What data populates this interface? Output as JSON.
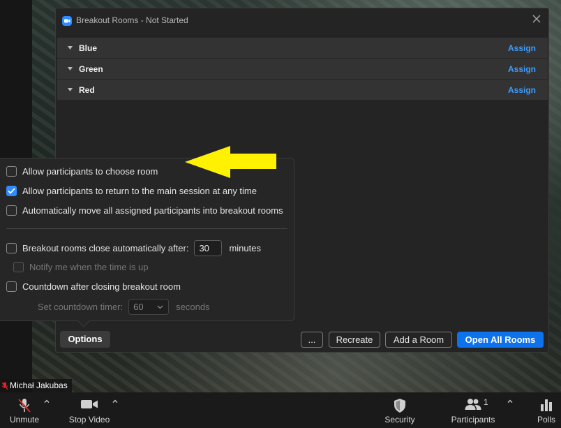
{
  "dialog": {
    "title": "Breakout Rooms - Not Started",
    "rooms": [
      {
        "name": "Blue",
        "action": "Assign"
      },
      {
        "name": "Green",
        "action": "Assign"
      },
      {
        "name": "Red",
        "action": "Assign"
      }
    ],
    "buttons": {
      "options": "Options",
      "more": "...",
      "recreate": "Recreate",
      "add_room": "Add a Room",
      "open_all": "Open All Rooms"
    }
  },
  "options": {
    "allow_choose": {
      "label": "Allow participants to choose room",
      "checked": false
    },
    "allow_return": {
      "label": "Allow participants to return to the main session at any time",
      "checked": true
    },
    "auto_move": {
      "label": "Automatically move all assigned participants into breakout rooms",
      "checked": false
    },
    "auto_close": {
      "label": "Breakout rooms close automatically after:",
      "value": "30",
      "unit": "minutes",
      "checked": false
    },
    "notify": {
      "label": "Notify me when the time is up",
      "checked": false
    },
    "countdown": {
      "label": "Countdown after closing breakout room",
      "checked": false
    },
    "countdown_timer": {
      "label": "Set countdown timer:",
      "value": "60",
      "unit": "seconds"
    }
  },
  "participant": {
    "name": "Michał Jakubas"
  },
  "toolbar": {
    "unmute": "Unmute",
    "stop_video": "Stop Video",
    "security": "Security",
    "participants": "Participants",
    "participants_count": "1",
    "polls": "Polls"
  },
  "colors": {
    "accent": "#2D8CFF",
    "primary_button": "#0E72ED",
    "link": "#3d9bff",
    "muted_red": "#E02828",
    "annotation_arrow": "#FFF200"
  },
  "icons": {
    "close": "close-icon",
    "mic": "mic-muted-icon",
    "video": "video-camera-icon",
    "security": "shield-icon",
    "participants": "people-icon",
    "polls": "bar-chart-icon"
  }
}
